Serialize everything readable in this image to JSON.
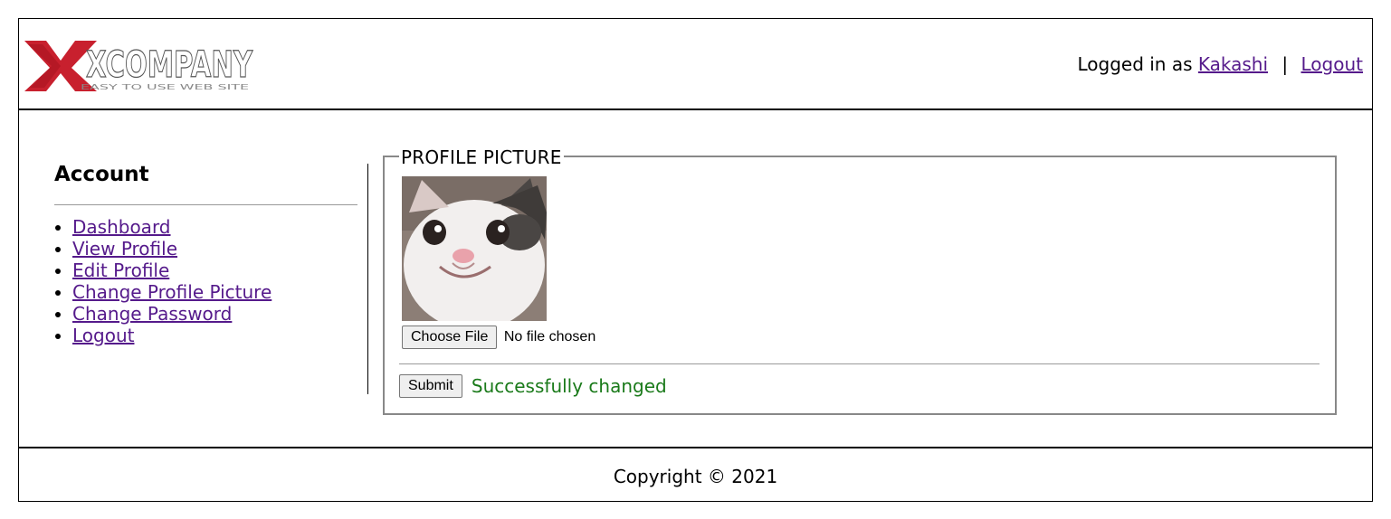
{
  "header": {
    "logo_text": "XCOMPANY",
    "logo_tagline": "EASY TO USE WEB SITE",
    "logged_in_prefix": "Logged in as",
    "username": "Kakashi",
    "separator": "|",
    "logout_label": "Logout"
  },
  "sidebar": {
    "title": "Account",
    "items": [
      {
        "label": "Dashboard"
      },
      {
        "label": "View Profile"
      },
      {
        "label": "Edit Profile"
      },
      {
        "label": "Change Profile Picture"
      },
      {
        "label": "Change Password"
      },
      {
        "label": "Logout"
      }
    ]
  },
  "profile_picture": {
    "legend": "PROFILE PICTURE",
    "choose_file_label": "Choose File",
    "file_status": "No file chosen",
    "submit_label": "Submit",
    "success_message": "Successfully changed"
  },
  "footer": {
    "copyright": "Copyright © 2021"
  },
  "colors": {
    "link": "#551a8b",
    "success": "#1a7a1a",
    "logo_red": "#c8202e"
  }
}
